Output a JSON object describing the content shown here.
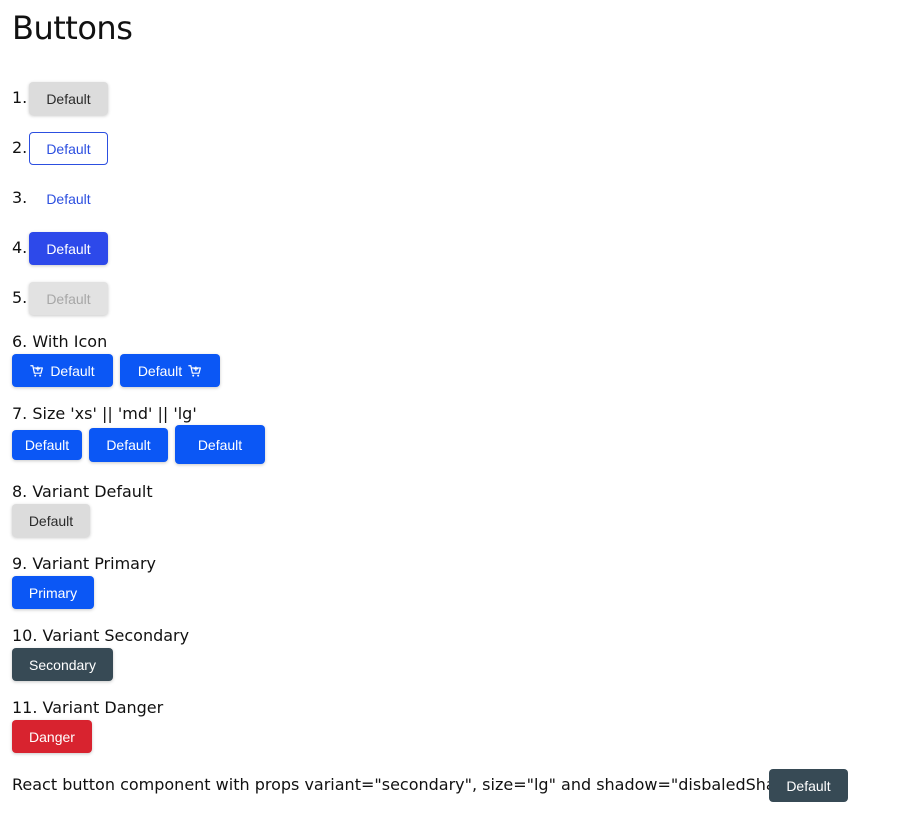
{
  "title": "Buttons",
  "numbered": [
    {
      "num": "1.",
      "label": "Default"
    },
    {
      "num": "2.",
      "label": "Default"
    },
    {
      "num": "3.",
      "label": "Default"
    },
    {
      "num": "4.",
      "label": "Default"
    },
    {
      "num": "5.",
      "label": "Default"
    }
  ],
  "sections": {
    "with_icon": {
      "title": "6. With Icon",
      "left_label": "Default",
      "right_label": "Default",
      "icon": "cart-plus-icon"
    },
    "size": {
      "title": "7. Size 'xs' || 'md' || 'lg'",
      "xs_label": "Default",
      "md_label": "Default",
      "lg_label": "Default"
    },
    "variant_default": {
      "title": "8. Variant Default",
      "label": "Default"
    },
    "variant_primary": {
      "title": "9. Variant Primary",
      "label": "Primary"
    },
    "variant_secondary": {
      "title": "10. Variant Secondary",
      "label": "Secondary"
    },
    "variant_danger": {
      "title": "11. Variant Danger",
      "label": "Danger"
    }
  },
  "footer": {
    "text": "React button component with props variant=\"secondary\", size=\"lg\" and shadow=\"disbaledShadow\".",
    "button_label": "Default"
  },
  "colors": {
    "default_bg": "#dcdcdc",
    "outline": "#2c4fe0",
    "blue": "#2d49ea",
    "primary": "#0b57f5",
    "secondary": "#374a55",
    "danger": "#d8232f",
    "disabled_text": "#a7a7a7"
  }
}
